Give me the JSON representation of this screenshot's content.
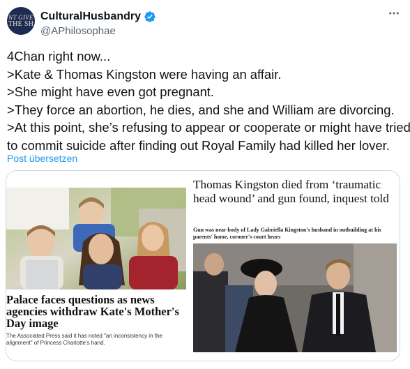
{
  "author": {
    "display_name": "CulturalHusbandry",
    "handle": "@APhilosophae",
    "verified": true,
    "avatar_text": [
      "NT GIVE",
      "THE SH"
    ]
  },
  "tweet": {
    "lines": [
      "4Chan right now...",
      ">Kate & Thomas Kingston were having an affair.",
      ">She might have even got pregnant.",
      ">They force an abortion, he dies, and she and William are divorcing.",
      ">At this point, she’s refusing to appear or cooperate or might have tried",
      "to commit suicide after finding out Royal Family had killed her lover."
    ],
    "translate_label": "Post übersetzen"
  },
  "media": {
    "left": {
      "headline": "Palace faces questions as news agencies withdraw Kate's Mother's Day image",
      "standfirst": "The Associated Press said it has noted \"an inconsistency in the alignment\" of Princess Charlotte's hand."
    },
    "right": {
      "headline": "Thomas Kingston died from ‘traumatic head wound’ and gun found, inquest told",
      "standfirst": "Gun was near body of Lady Gabriella Kingston's husband in outbuilding at his parents' home, coroner's court hears"
    }
  },
  "icons": {
    "more": "more-options-icon",
    "verified": "verified-badge-icon"
  },
  "colors": {
    "accent": "#1d9bf0",
    "secondary_text": "#536471",
    "border": "#cfd9de"
  }
}
